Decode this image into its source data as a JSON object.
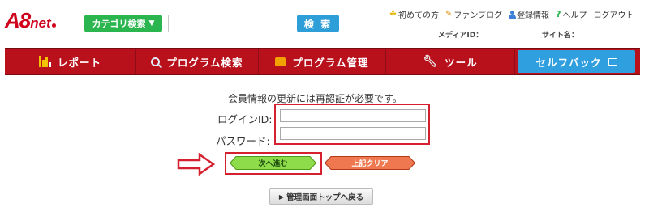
{
  "logo": {
    "main": "A8",
    "sub": "net"
  },
  "search": {
    "category_label": "カテゴリ検索",
    "category_arrow": "▼",
    "button_label": "検 索",
    "input_value": ""
  },
  "top_links": [
    {
      "label": "初めての方",
      "icon": "sprout-icon"
    },
    {
      "label": "ファンブログ",
      "icon": "pen-icon"
    },
    {
      "label": "登録情報",
      "icon": "user-icon"
    },
    {
      "label": "ヘルプ",
      "icon": "question-icon"
    },
    {
      "label": "ログアウト",
      "icon": ""
    }
  ],
  "meta": {
    "media_id_label": "メディアID：",
    "site_name_label": "サイト名："
  },
  "nav": {
    "items": [
      {
        "label": "レポート",
        "icon": "bar-chart-icon"
      },
      {
        "label": "プログラム検索",
        "icon": "search-icon"
      },
      {
        "label": "プログラム管理",
        "icon": "folder-icon"
      },
      {
        "label": "ツール",
        "icon": "wrench-icon"
      },
      {
        "label": "セルフバック",
        "icon": "window-icon"
      }
    ]
  },
  "form": {
    "notice": "会員情報の更新には再認証が必要です。",
    "login_label": "ログインID:",
    "password_label": "パスワード:",
    "login_value": "",
    "password_value": "",
    "next_button": "次へ進む",
    "clear_button": "上記クリア",
    "back_button": "管理画面トップへ戻る"
  },
  "colors": {
    "nav_red": "#b8111c",
    "highlight_red": "#d5202f",
    "green": "#2bb54f",
    "blue": "#2d9ed8"
  }
}
